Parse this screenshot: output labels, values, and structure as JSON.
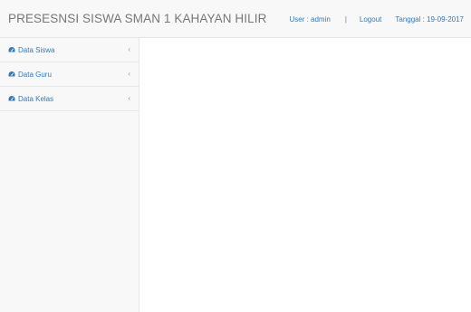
{
  "app": {
    "title": "PRESESNSI SISWA SMAN 1 KAHAYAN HILIR"
  },
  "header": {
    "user_text": "User : admin",
    "separator": "|",
    "logout_label": "Logout",
    "date_text": "Tanggal : 19-09-2017"
  },
  "sidebar": {
    "items": [
      {
        "label": "Data Siswa",
        "icon": "dashboard-icon",
        "arrow": "‹"
      },
      {
        "label": "Data Guru",
        "icon": "dashboard-icon",
        "arrow": "‹"
      },
      {
        "label": "Data Kelas",
        "icon": "dashboard-icon",
        "arrow": "‹"
      }
    ]
  },
  "colors": {
    "link": "#337ab7",
    "brand": "#777777",
    "navbar_bg": "#f8f8f8",
    "border": "#e7e7e7"
  }
}
